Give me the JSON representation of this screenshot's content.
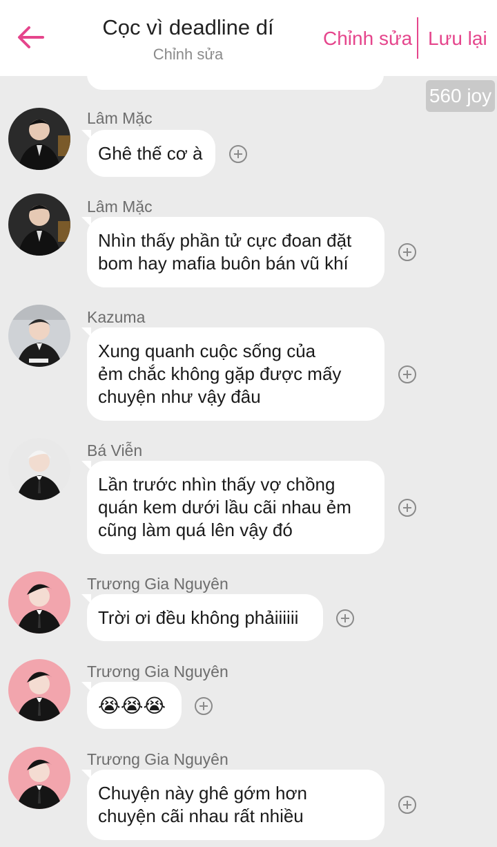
{
  "header": {
    "title": "Cọc vì deadline dí",
    "subtitle": "Chỉnh sửa",
    "edit_label": "Chỉnh sửa",
    "save_label": "Lưu lại",
    "accent_color": "#e5458c"
  },
  "joy_badge": "560 joy",
  "messages": [
    {
      "sender": "Lâm Mặc",
      "lines": [
        "Ghê thế cơ à"
      ]
    },
    {
      "sender": "Lâm Mặc",
      "lines": [
        "Nhìn thấy phần tử cực đoan đặt",
        "bom hay mafia buôn bán vũ khí"
      ]
    },
    {
      "sender": "Kazuma",
      "lines": [
        "Xung quanh cuộc sống của",
        "ẻm chắc không gặp được mấy",
        "chuyện như vậy đâu"
      ]
    },
    {
      "sender": "Bá Viễn",
      "lines": [
        "Lần trước nhìn thấy vợ chồng",
        "quán kem dưới lầu cãi nhau ẻm",
        "cũng làm quá lên vậy đó"
      ]
    },
    {
      "sender": "Trương Gia Nguyên",
      "lines": [
        "Trời ơi đều không phảiiiiii"
      ]
    },
    {
      "sender": "Trương Gia Nguyên",
      "lines": [
        "😭😭😭"
      ]
    },
    {
      "sender": "Trương Gia Nguyên",
      "lines": [
        "Chuyện này ghê gớm hơn",
        "chuyện cãi nhau rất nhiều"
      ]
    }
  ]
}
